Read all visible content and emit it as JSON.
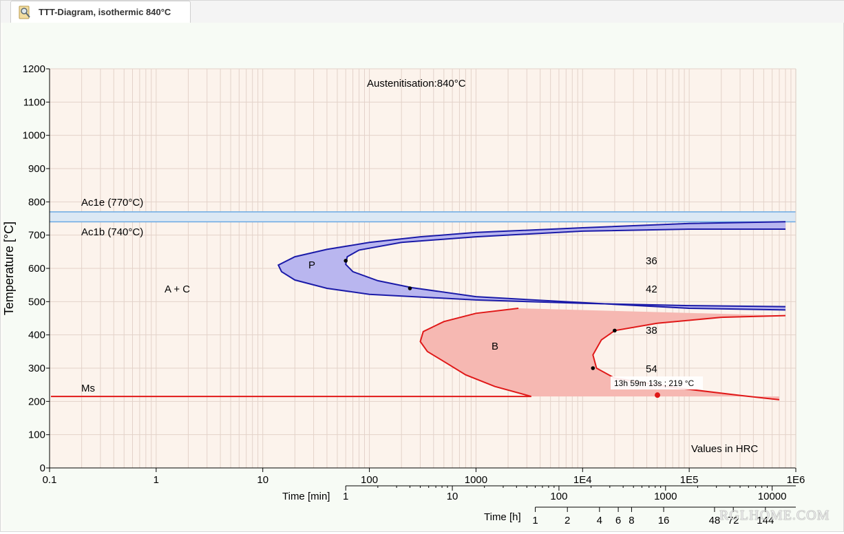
{
  "window": {
    "tab_title": "TTT-Diagram, isothermic 840°C",
    "tab_icon": "magnifier-document-icon"
  },
  "colors": {
    "plot_bg": "#fcf3ec",
    "grid": "#e3d2c9",
    "blue_line": "#1a1aa8",
    "blue_fill": "#b9b6ef",
    "red_line": "#e01818",
    "red_fill": "#f6b8b2",
    "ac_line": "#6aa8e2",
    "ac_band": "#dbe8f4"
  },
  "chart_data": {
    "type": "line",
    "xscale": "log",
    "xlim": [
      0.1,
      1000000
    ],
    "ylim": [
      0,
      1200
    ],
    "ylabel": "Temperature [°C]",
    "x_ticks": [
      "0.1",
      "1",
      "10",
      "100",
      "1000",
      "1E4",
      "1E5",
      "1E6"
    ],
    "y_ticks": [
      "0",
      "100",
      "200",
      "300",
      "400",
      "500",
      "600",
      "700",
      "800",
      "900",
      "1000",
      "1100",
      "1200"
    ],
    "secondary_axes": {
      "minutes": {
        "label": "Time [min]",
        "ticks": [
          {
            "label": "1",
            "seconds": 60
          },
          {
            "label": "10",
            "seconds": 600
          },
          {
            "label": "100",
            "seconds": 6000
          },
          {
            "label": "1000",
            "seconds": 60000
          },
          {
            "label": "10000",
            "seconds": 600000
          }
        ]
      },
      "hours": {
        "label": "Time [h]",
        "ticks": [
          {
            "label": "1",
            "seconds": 3600
          },
          {
            "label": "2",
            "seconds": 7200
          },
          {
            "label": "4",
            "seconds": 14400
          },
          {
            "label": "6",
            "seconds": 21600
          },
          {
            "label": "8",
            "seconds": 28800
          },
          {
            "label": "16",
            "seconds": 57600
          },
          {
            "label": "48",
            "seconds": 172800
          },
          {
            "label": "72",
            "seconds": 259200
          },
          {
            "label": "144",
            "seconds": 518400
          }
        ]
      }
    },
    "reference_lines": [
      {
        "name": "Ac1e (770°C)",
        "y": 770
      },
      {
        "name": "Ac1b (740°C)",
        "y": 740
      }
    ],
    "ms_line": {
      "name": "Ms",
      "y": 215,
      "x_end": 3300
    },
    "pearlite": {
      "label": "P",
      "start_curve": [
        [
          800000,
          740
        ],
        [
          100000,
          735
        ],
        [
          10000,
          722
        ],
        [
          1000,
          708
        ],
        [
          300,
          695
        ],
        [
          100,
          678
        ],
        [
          40,
          657
        ],
        [
          20,
          635
        ],
        [
          14,
          610
        ],
        [
          15,
          590
        ],
        [
          20,
          565
        ],
        [
          40,
          540
        ],
        [
          100,
          522
        ],
        [
          1000,
          505
        ],
        [
          10000,
          495
        ],
        [
          100000,
          488
        ],
        [
          800000,
          485
        ]
      ],
      "finish_curve": [
        [
          800000,
          718
        ],
        [
          100000,
          718
        ],
        [
          10000,
          712
        ],
        [
          1000,
          695
        ],
        [
          200,
          678
        ],
        [
          80,
          655
        ],
        [
          62,
          635
        ],
        [
          60,
          612
        ],
        [
          70,
          590
        ],
        [
          120,
          563
        ],
        [
          250,
          542
        ],
        [
          1000,
          515
        ],
        [
          10000,
          497
        ],
        [
          100000,
          480
        ],
        [
          800000,
          475
        ]
      ]
    },
    "bainite": {
      "label": "B",
      "start_curve": [
        [
          2500,
          480
        ],
        [
          1000,
          465
        ],
        [
          500,
          440
        ],
        [
          320,
          410
        ],
        [
          300,
          380
        ],
        [
          350,
          350
        ],
        [
          500,
          320
        ],
        [
          800,
          280
        ],
        [
          1500,
          245
        ],
        [
          3300,
          215
        ]
      ],
      "finish_curve": [
        [
          800000,
          458
        ],
        [
          200000,
          453
        ],
        [
          50000,
          435
        ],
        [
          20000,
          413
        ],
        [
          15000,
          385
        ],
        [
          12500,
          340
        ],
        [
          13500,
          300
        ],
        [
          20000,
          270
        ],
        [
          80000,
          240
        ],
        [
          300000,
          218
        ],
        [
          700000,
          205
        ]
      ]
    },
    "hardness_labels": [
      "36",
      "42",
      "38",
      "54"
    ],
    "marked_points": [
      [
        60,
        623
      ],
      [
        240,
        540
      ],
      [
        20000,
        413
      ],
      [
        12500,
        300
      ]
    ],
    "cursor": {
      "x": 50353,
      "y": 219,
      "label": "13h 59m 13s ; 219 °C"
    },
    "region_label": "A + C",
    "annotation_top": "Austenitisation:840°C",
    "annotation_bottom": "Values in HRC"
  },
  "watermark": "RGLHOME.COM"
}
